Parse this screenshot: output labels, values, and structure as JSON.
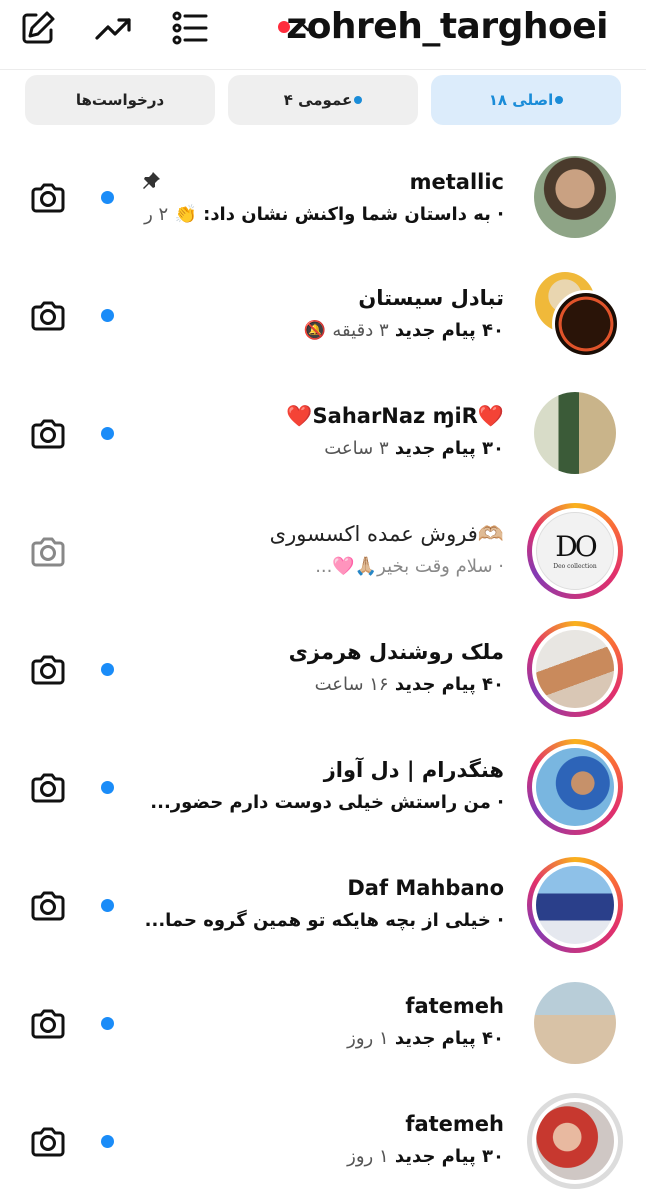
{
  "header": {
    "username": "zohreh_targhoei",
    "icons": [
      "compose-icon",
      "trending-icon",
      "list-icon",
      "chevron-down-icon"
    ]
  },
  "tabs": [
    {
      "label": "اصلی ۱۸",
      "active": true,
      "dot": true
    },
    {
      "label": "عمومی ۴",
      "active": false,
      "dot": true
    },
    {
      "label": "درخواست‌ها",
      "active": false,
      "dot": false
    }
  ],
  "conversations": [
    {
      "name": "metallic",
      "preview": "· به داستان شما واکنش نشان داد: 👏",
      "time": "۲ ر",
      "unread": true,
      "pinned": true
    },
    {
      "name": "تبادل سیستان",
      "preview": "۴۰ پیام جدید",
      "time": "۳ دقیقه",
      "unread": true,
      "muted": true
    },
    {
      "name": "❤️SaharNaz ɱiR❤️",
      "preview": "۳۰ پیام جدید",
      "time": "۳ ساعت",
      "unread": true
    },
    {
      "name": "فروش عمده اکسسوری🫶🏼",
      "preview": "· سلام وقت بخیر🙏🏼🩷...",
      "time": "",
      "unread": false
    },
    {
      "name": "ملک روشندل هرمزی",
      "preview": "۴۰ پیام جدید",
      "time": "۱۶ ساعت",
      "unread": true
    },
    {
      "name": "هنگدرام | دل آواز",
      "preview": "· من راستش خیلی دوست دارم حضور...",
      "time": "",
      "unread": true
    },
    {
      "name": "Daf Mahbano",
      "preview": "· خیلی از بچه هایکه تو همین گروه حما...",
      "time": "",
      "unread": true
    },
    {
      "name": "fatemeh",
      "preview": "۴۰ پیام جدید",
      "time": "۱ روز",
      "unread": true
    },
    {
      "name": "fatemeh",
      "preview": "۳۰ پیام جدید",
      "time": "۱ روز",
      "unread": true
    }
  ],
  "avatar_logo_text": "DO",
  "avatar_logo_sub": "Deo collection",
  "colors": {
    "accent": "#1a8cd8",
    "unread_dot": "#1a8cf8",
    "red_dot": "#ff2d3d"
  }
}
